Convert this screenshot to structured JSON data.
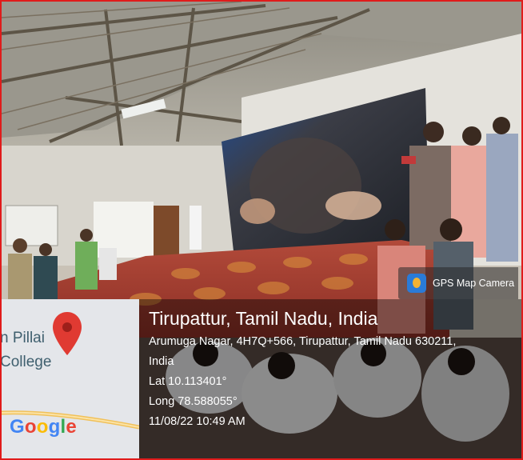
{
  "location": {
    "title": "Tirupattur, Tamil Nadu, India",
    "address_line1": "Arumuga Nagar, 4H7Q+566, Tirupattur, Tamil Nadu 630211,",
    "address_line2": "India",
    "lat": "Lat 10.113401°",
    "long": "Long 78.588055°",
    "datetime": "11/08/22 10:49 AM"
  },
  "badge": {
    "label": "GPS Map Camera",
    "icon": "gps-map-camera-app-icon"
  },
  "map": {
    "place_label": "n Pillai\nCollege",
    "google": [
      {
        "ch": "G",
        "color": "#4285f4"
      },
      {
        "ch": "o",
        "color": "#ea4335"
      },
      {
        "ch": "o",
        "color": "#fbbc05"
      },
      {
        "ch": "g",
        "color": "#4285f4"
      },
      {
        "ch": "l",
        "color": "#34a853"
      },
      {
        "ch": "e",
        "color": "#ea4335"
      }
    ],
    "pin_color": "#e03a32"
  },
  "colors": {
    "frame_border": "#e01b1b"
  }
}
